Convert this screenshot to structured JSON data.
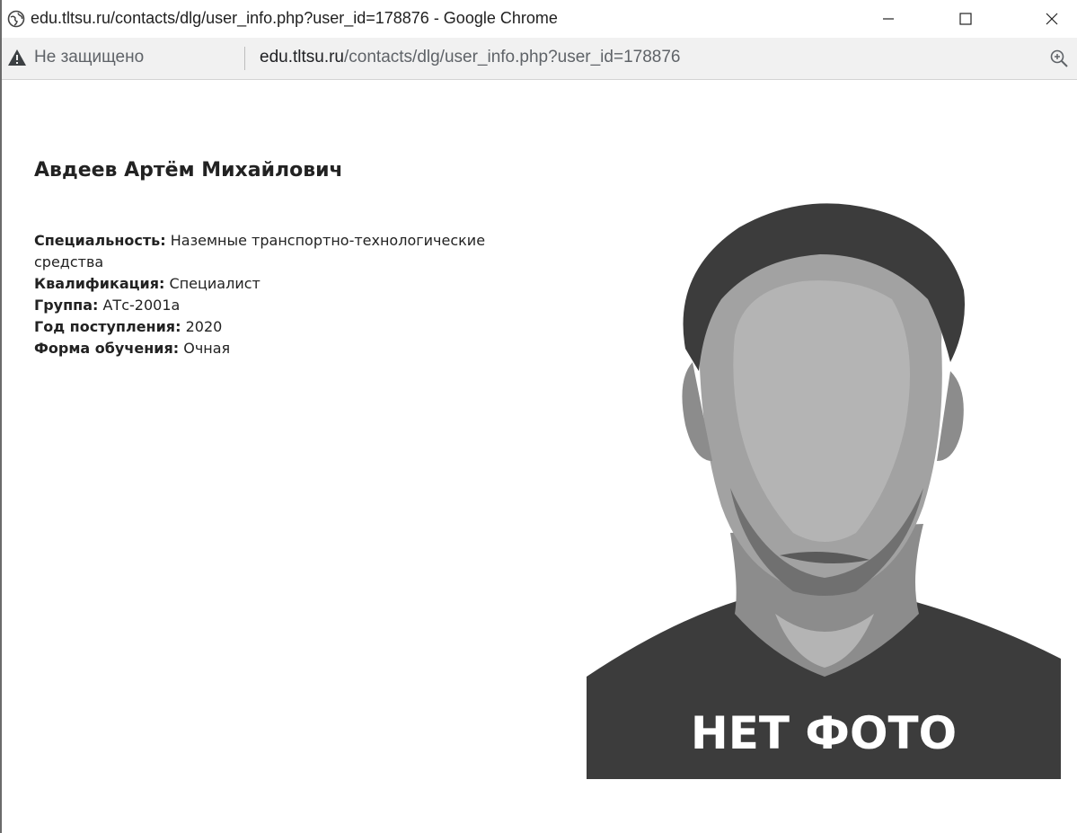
{
  "window": {
    "title": "edu.tltsu.ru/contacts/dlg/user_info.php?user_id=178876 - Google Chrome",
    "controls": {
      "minimize": "—",
      "maximize": "☐",
      "close": "✕"
    }
  },
  "addressbar": {
    "security_label": "Не защищено",
    "url_host": "edu.tltsu.ru",
    "url_path": "/contacts/dlg/user_info.php?user_id=178876",
    "icons": {
      "security": "warning-icon",
      "zoom": "zoom-icon"
    }
  },
  "profile": {
    "name": "Авдеев Артём Михайлович",
    "fields": [
      {
        "label": "Специальность:",
        "value": "Наземные транспортно-технологические средства"
      },
      {
        "label": "Квалификация:",
        "value": "Специалист"
      },
      {
        "label": "Группа:",
        "value": "АТс-2001а"
      },
      {
        "label": "Год поступления:",
        "value": "2020"
      },
      {
        "label": "Форма обучения:",
        "value": "Очная"
      }
    ],
    "photo_caption": "НЕТ ФОТО"
  },
  "colors": {
    "photo_dark": "#3c3c3c",
    "photo_mid": "#8c8c8c",
    "photo_light": "#b4b4b4",
    "text": "#222222"
  }
}
